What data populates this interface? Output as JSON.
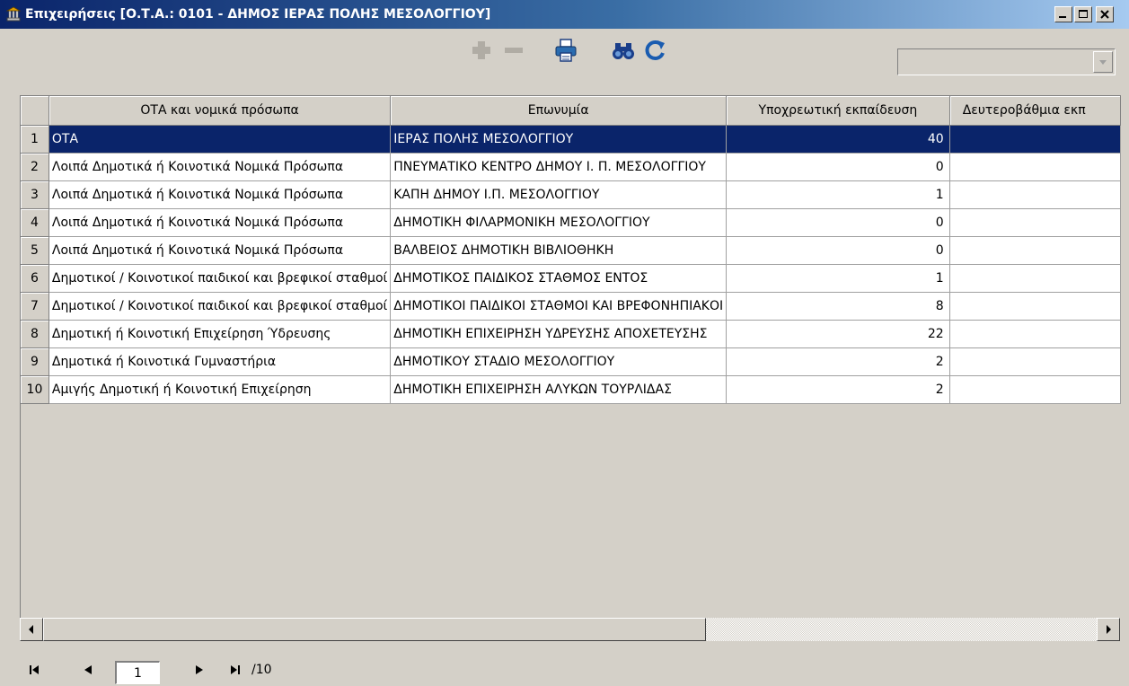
{
  "window": {
    "title": "Επιχειρήσεις [Ο.Τ.Α.: 0101 - ΔΗΜΟΣ ΙΕΡΑΣ ΠΟΛΗΣ ΜΕΣΟΛΟΓΓΙΟΥ]",
    "controls": [
      "minimize",
      "maximize",
      "close"
    ]
  },
  "toolbar": {
    "icons": [
      "add-icon",
      "remove-icon",
      "print-icon",
      "find-icon",
      "refresh-icon"
    ],
    "filter_select": {
      "value": ""
    }
  },
  "table": {
    "columns": [
      "ΟΤΑ και νομικά πρόσωπα",
      "Επωνυμία",
      "Υποχρεωτική εκπαίδευση",
      "Δευτεροβάθμια εκπ"
    ],
    "rows": [
      {
        "num": "1",
        "type": "ΟΤΑ",
        "name": "ΙΕΡΑΣ ΠΟΛΗΣ ΜΕΣΟΛΟΓΓΙΟΥ",
        "compulsory": "40",
        "secondary": ""
      },
      {
        "num": "2",
        "type": "Λοιπά Δημοτικά ή Κοινοτικά Νομικά Πρόσωπα",
        "name": "ΠΝΕΥΜΑΤΙΚΟ ΚΕΝΤΡΟ ΔΗΜΟΥ Ι. Π. ΜΕΣΟΛΟΓΓΙΟΥ",
        "compulsory": "0",
        "secondary": ""
      },
      {
        "num": "3",
        "type": "Λοιπά Δημοτικά ή Κοινοτικά Νομικά Πρόσωπα",
        "name": "ΚΑΠΗ ΔΗΜΟΥ Ι.Π. ΜΕΣΟΛΟΓΓΙΟΥ",
        "compulsory": "1",
        "secondary": ""
      },
      {
        "num": "4",
        "type": "Λοιπά Δημοτικά ή Κοινοτικά Νομικά Πρόσωπα",
        "name": "ΔΗΜΟΤΙΚΗ ΦΙΛΑΡΜΟΝΙΚΗ ΜΕΣΟΛΟΓΓΙΟΥ",
        "compulsory": "0",
        "secondary": ""
      },
      {
        "num": "5",
        "type": "Λοιπά Δημοτικά ή Κοινοτικά Νομικά Πρόσωπα",
        "name": "ΒΑΛΒΕΙΟΣ ΔΗΜΟΤΙΚΗ ΒΙΒΛΙΟΘΗΚΗ",
        "compulsory": "0",
        "secondary": ""
      },
      {
        "num": "6",
        "type": "Δημοτικοί / Κοινοτικοί παιδικοί και βρεφικοί σταθμοί",
        "name": "ΔΗΜΟΤΙΚΟΣ ΠΑΙΔΙΚΟΣ ΣΤΑΘΜΟΣ ΕΝΤΟΣ",
        "compulsory": "1",
        "secondary": ""
      },
      {
        "num": "7",
        "type": "Δημοτικοί / Κοινοτικοί παιδικοί και βρεφικοί σταθμοί",
        "name": "ΔΗΜΟΤΙΚΟΙ ΠΑΙΔΙΚΟΙ ΣΤΑΘΜΟΙ ΚΑΙ ΒΡΕΦΟΝΗΠΙΑΚΟΙ",
        "compulsory": "8",
        "secondary": ""
      },
      {
        "num": "8",
        "type": "Δημοτική ή Κοινοτική Επιχείρηση Ύδρευσης",
        "name": "ΔΗΜΟΤΙΚΗ ΕΠΙΧΕΙΡΗΣΗ ΥΔΡΕΥΣΗΣ ΑΠΟΧΕΤΕΥΣΗΣ",
        "compulsory": "22",
        "secondary": ""
      },
      {
        "num": "9",
        "type": "Δημοτικά ή Κοινοτικά Γυμναστήρια",
        "name": "ΔΗΜΟΤΙΚΟΥ ΣΤΑΔΙΟ ΜΕΣΟΛΟΓΓΙΟΥ",
        "compulsory": "2",
        "secondary": ""
      },
      {
        "num": "10",
        "type": "Αμιγής Δημοτική ή Κοινοτική Επιχείρηση",
        "name": "ΔΗΜΟΤΙΚΗ ΕΠΙΧΕΙΡΗΣΗ ΑΛΥΚΩΝ ΤΟΥΡΛΙΔΑΣ",
        "compulsory": "2",
        "secondary": ""
      }
    ],
    "selected_row": 1
  },
  "pager": {
    "current_page": "1",
    "total_label": "/10"
  }
}
